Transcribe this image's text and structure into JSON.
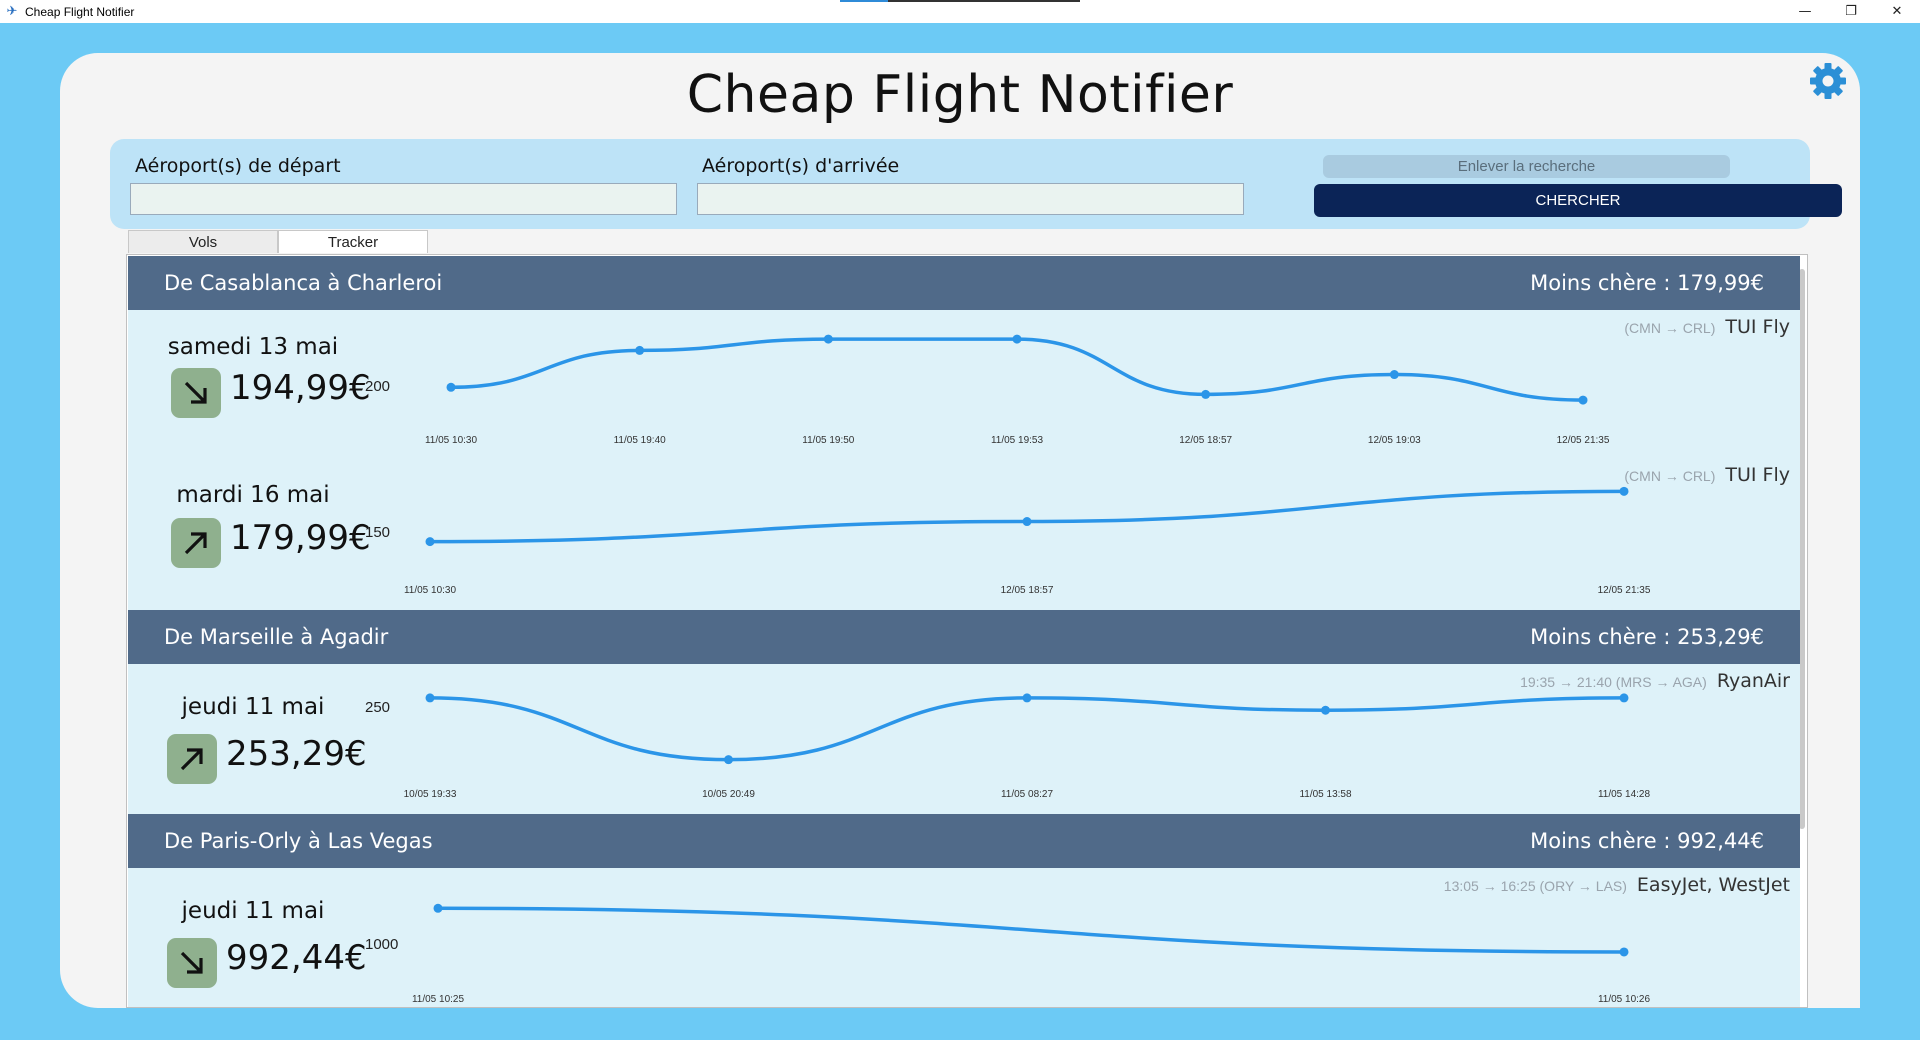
{
  "window": {
    "title": "Cheap Flight Notifier",
    "controls": {
      "minimize": "—",
      "restore": "❐",
      "close": "✕"
    }
  },
  "app": {
    "title": "Cheap Flight Notifier"
  },
  "search": {
    "departure_label": "Aéroport(s) de départ",
    "departure_value": "",
    "arrival_label": "Aéroport(s) d'arrivée",
    "arrival_value": "",
    "clear_label": "Enlever la recherche",
    "search_label": "CHERCHER"
  },
  "tabs": [
    {
      "label": "Vols",
      "active": false
    },
    {
      "label": "Tracker",
      "active": true
    }
  ],
  "colors": {
    "background": "#6ccaf5",
    "header": "#506a89",
    "row": "#def2f9",
    "line": "#2b95e8",
    "trend_badge": "#8fb08e",
    "search_button": "#0b2457"
  },
  "routes": [
    {
      "title": "De Casablanca à Charleroi",
      "cheapest": "Moins chère : 179,99€",
      "flights": [
        {
          "date": "samedi 13 mai",
          "price": "194,99€",
          "trend": "down",
          "y_tick": "200",
          "route_code": "(CMN → CRL)",
          "airline": "TUI Fly",
          "chart_data": {
            "type": "line",
            "x": [
              "11/05 10:30",
              "11/05 19:40",
              "11/05 19:50",
              "11/05 19:53",
              "12/05 18:57",
              "12/05 19:03",
              "12/05 21:35"
            ],
            "values": [
              206,
              232,
              240,
              240,
              201,
              215,
              197
            ]
          }
        },
        {
          "date": "mardi 16 mai",
          "price": "179,99€",
          "trend": "up",
          "y_tick": "150",
          "route_code": "(CMN → CRL)",
          "airline": "TUI Fly",
          "chart_data": {
            "type": "line",
            "x": [
              "11/05 10:30",
              "12/05 18:57",
              "12/05 21:35"
            ],
            "values": [
              150,
              162,
              180
            ],
            "x_labels_shown": [
              "11/05 10:30",
              "12/05 18:57",
              "12/05 21:35"
            ]
          }
        }
      ]
    },
    {
      "title": "De Marseille à Agadir",
      "cheapest": "Moins chère : 253,29€",
      "flights": [
        {
          "date": "jeudi 11 mai",
          "price": "253,29€",
          "trend": "up",
          "y_tick": "250",
          "route_code": "19:35 → 21:40 (MRS → AGA)",
          "airline": "RyanAir",
          "chart_data": {
            "type": "line",
            "x": [
              "10/05 19:33",
              "10/05 20:49",
              "11/05 08:27",
              "11/05 13:58",
              "11/05 14:28"
            ],
            "values": [
              253,
              213,
              253,
              245,
              253
            ]
          }
        }
      ]
    },
    {
      "title": "De Paris-Orly à Las Vegas",
      "cheapest": "Moins chère : 992,44€",
      "flights": [
        {
          "date": "jeudi 11 mai",
          "price": "992,44€",
          "trend": "down",
          "y_tick": "1000",
          "route_code": "13:05 → 16:25 (ORY → LAS)",
          "airline": "EasyJet, WestJet",
          "chart_data": {
            "type": "line",
            "x": [
              "11/05 10:25",
              "11/05 10:26"
            ],
            "values": [
              1030,
              992
            ]
          }
        }
      ]
    }
  ]
}
